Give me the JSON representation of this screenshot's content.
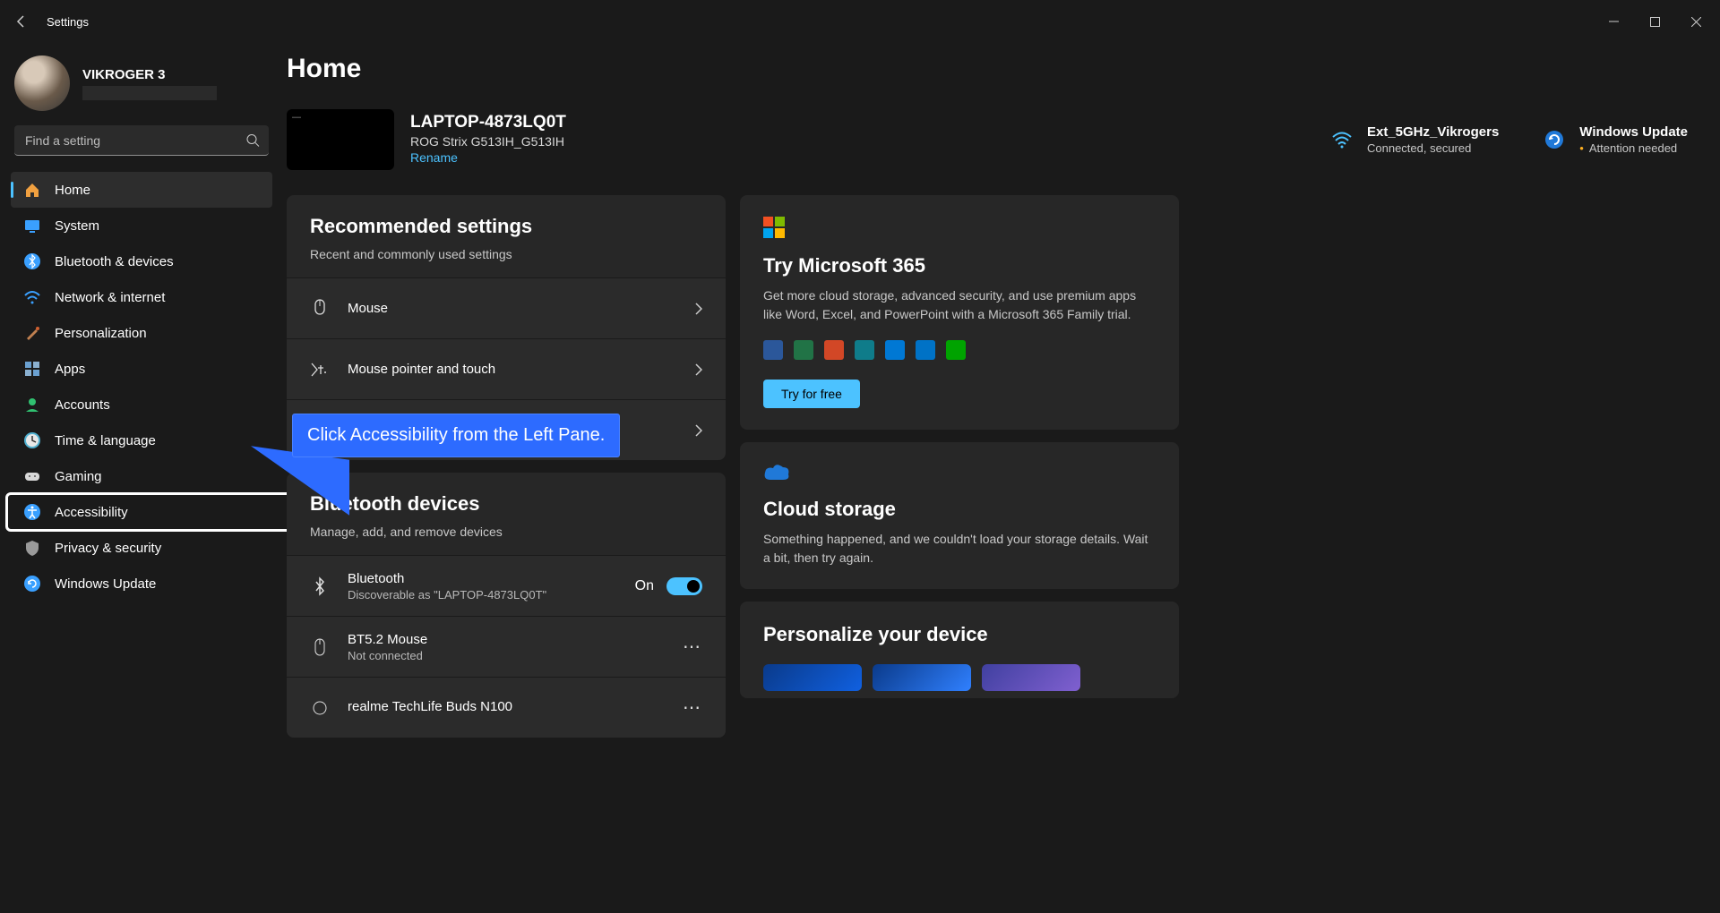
{
  "titlebar": {
    "title": "Settings"
  },
  "user": {
    "name": "VIKROGER 3"
  },
  "search": {
    "placeholder": "Find a setting"
  },
  "nav": [
    {
      "label": "Home",
      "icon": "home",
      "active": true
    },
    {
      "label": "System",
      "icon": "system",
      "active": false
    },
    {
      "label": "Bluetooth & devices",
      "icon": "bluetooth",
      "active": false
    },
    {
      "label": "Network & internet",
      "icon": "wifi",
      "active": false
    },
    {
      "label": "Personalization",
      "icon": "brush",
      "active": false
    },
    {
      "label": "Apps",
      "icon": "apps",
      "active": false
    },
    {
      "label": "Accounts",
      "icon": "person",
      "active": false
    },
    {
      "label": "Time & language",
      "icon": "clock",
      "active": false
    },
    {
      "label": "Gaming",
      "icon": "gamepad",
      "active": false
    },
    {
      "label": "Accessibility",
      "icon": "accessibility",
      "active": false,
      "highlighted": true
    },
    {
      "label": "Privacy & security",
      "icon": "shield",
      "active": false
    },
    {
      "label": "Windows Update",
      "icon": "update",
      "active": false
    }
  ],
  "page": {
    "title": "Home"
  },
  "device": {
    "name": "LAPTOP-4873LQ0T",
    "model": "ROG Strix G513IH_G513IH",
    "rename": "Rename"
  },
  "status": {
    "wifi": {
      "title": "Ext_5GHz_Vikrogers",
      "sub": "Connected, secured"
    },
    "update": {
      "title": "Windows Update",
      "sub": "Attention needed"
    }
  },
  "recommended": {
    "title": "Recommended settings",
    "sub": "Recent and commonly used settings",
    "items": [
      {
        "label": "Mouse"
      },
      {
        "label": "Mouse pointer and touch"
      },
      {
        "label": ""
      }
    ]
  },
  "bluetooth_section": {
    "title": "Bluetooth devices",
    "sub": "Manage, add, and remove devices",
    "bt_row": {
      "label": "Bluetooth",
      "sub": "Discoverable as \"LAPTOP-4873LQ0T\"",
      "state": "On"
    },
    "devices": [
      {
        "label": "BT5.2 Mouse",
        "sub": "Not connected"
      },
      {
        "label": "realme TechLife Buds N100",
        "sub": ""
      }
    ]
  },
  "m365": {
    "title": "Try Microsoft 365",
    "body": "Get more cloud storage, advanced security, and use premium apps like Word, Excel, and PowerPoint with a Microsoft 365 Family trial.",
    "cta": "Try for free"
  },
  "cloud": {
    "title": "Cloud storage",
    "body": "Something happened, and we couldn't load your storage details. Wait a bit, then try again."
  },
  "personalize": {
    "title": "Personalize your device"
  },
  "callout": {
    "text": "Click Accessibility from the Left Pane."
  },
  "icon_colors": {
    "home": "#f0a040",
    "system": "#3aa0ff",
    "bluetooth": "#3aa0ff",
    "wifi": "#3aa0ff",
    "brush": "#c08050",
    "apps": "#6aa0d0",
    "person": "#30c070",
    "clock": "#50b0d0",
    "gamepad": "#d8d8d8",
    "accessibility": "#3aa0ff",
    "shield": "#9a9a9a",
    "update": "#3aa0ff"
  },
  "app_icon_colors": [
    "#2b579a",
    "#217346",
    "#d24726",
    "#0f7c8a",
    "#0078d4",
    "#0072c6",
    "#00a300"
  ]
}
